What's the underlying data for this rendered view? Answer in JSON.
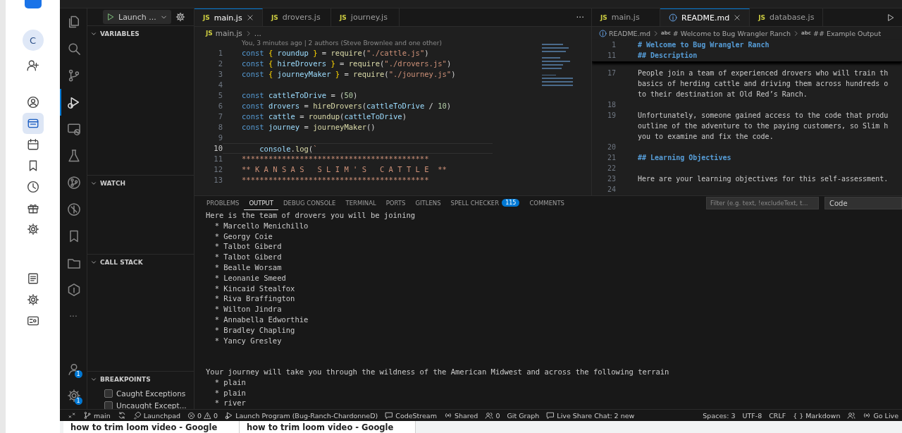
{
  "rail": {
    "avatar": "C",
    "items": [
      {
        "selected": false
      },
      {
        "selected": false
      },
      {
        "selected": true
      },
      {
        "selected": false
      },
      {
        "selected": false
      },
      {
        "selected": false
      },
      {
        "selected": false
      },
      {
        "selected": false
      },
      {
        "selected": false
      },
      {
        "selected": false
      },
      {
        "selected": false
      }
    ]
  },
  "activity_bar": {
    "items": [
      {
        "selected": false
      },
      {
        "selected": false
      },
      {
        "selected": false
      },
      {
        "selected": true
      },
      {
        "selected": false
      },
      {
        "selected": false
      },
      {
        "selected": false
      },
      {
        "selected": false
      },
      {
        "selected": false
      },
      {
        "selected": false
      },
      {
        "selected": false
      }
    ],
    "more": "···",
    "account_badge": "1",
    "manage_badge": "1"
  },
  "debug_toolbar": {
    "config": "Launch ..."
  },
  "sidebar": {
    "sections": [
      {
        "title": "VARIABLES",
        "expanded": true
      },
      {
        "title": "WATCH",
        "expanded": true
      },
      {
        "title": "CALL STACK",
        "expanded": true
      },
      {
        "title": "BREAKPOINTS",
        "expanded": true,
        "items": [
          {
            "label": "Caught Exceptions",
            "checked": false
          },
          {
            "label": "Uncaught Except...",
            "checked": false
          }
        ]
      }
    ]
  },
  "left_editor": {
    "tabs": [
      {
        "label": "main.js",
        "kind": "js",
        "icon_text": "JS",
        "selected": true
      },
      {
        "label": "drovers.js",
        "kind": "js",
        "icon_text": "JS",
        "selected": false
      },
      {
        "label": "journey.js",
        "kind": "js",
        "icon_text": "JS",
        "selected": false
      }
    ],
    "more": "···",
    "breadcrumb": [
      {
        "icon_text": "JS",
        "text": "main.js"
      },
      {
        "text": "..."
      }
    ],
    "blame": "You, 3 minutes ago | 2 authors (Steve Brownlee and one other)",
    "lines": [
      {
        "number": "1",
        "current": false,
        "tokens": [
          {
            "kind": "kw",
            "text": "const "
          },
          {
            "kind": "brace",
            "text": "{ "
          },
          {
            "kind": "var",
            "text": "roundup"
          },
          {
            "kind": "brace",
            "text": " }"
          },
          {
            "kind": "punct",
            "text": " = "
          },
          {
            "kind": "func",
            "text": "require"
          },
          {
            "kind": "punct",
            "text": "("
          },
          {
            "kind": "str",
            "text": "\"./cattle.js\""
          },
          {
            "kind": "punct",
            "text": ")"
          }
        ]
      },
      {
        "number": "2",
        "current": false,
        "tokens": [
          {
            "kind": "kw",
            "text": "const "
          },
          {
            "kind": "brace",
            "text": "{ "
          },
          {
            "kind": "var",
            "text": "hireDrovers"
          },
          {
            "kind": "brace",
            "text": " }"
          },
          {
            "kind": "punct",
            "text": " = "
          },
          {
            "kind": "func",
            "text": "require"
          },
          {
            "kind": "punct",
            "text": "("
          },
          {
            "kind": "str",
            "text": "\"./drovers.js\""
          },
          {
            "kind": "punct",
            "text": ")"
          }
        ]
      },
      {
        "number": "3",
        "current": false,
        "tokens": [
          {
            "kind": "kw",
            "text": "const "
          },
          {
            "kind": "brace",
            "text": "{ "
          },
          {
            "kind": "var",
            "text": "journeyMaker"
          },
          {
            "kind": "brace",
            "text": " }"
          },
          {
            "kind": "punct",
            "text": " = "
          },
          {
            "kind": "func",
            "text": "require"
          },
          {
            "kind": "punct",
            "text": "("
          },
          {
            "kind": "str",
            "text": "\"./journey.js\""
          },
          {
            "kind": "punct",
            "text": ")"
          }
        ]
      },
      {
        "number": "4",
        "current": false
      },
      {
        "number": "5",
        "current": false,
        "tokens": [
          {
            "kind": "kw",
            "text": "const "
          },
          {
            "kind": "var",
            "text": "cattleToDrive"
          },
          {
            "kind": "punct",
            "text": " = ("
          },
          {
            "kind": "num",
            "text": "50"
          },
          {
            "kind": "punct",
            "text": ")"
          }
        ]
      },
      {
        "number": "6",
        "current": false,
        "tokens": [
          {
            "kind": "kw",
            "text": "const "
          },
          {
            "kind": "var",
            "text": "drovers"
          },
          {
            "kind": "punct",
            "text": " = "
          },
          {
            "kind": "func",
            "text": "hireDrovers"
          },
          {
            "kind": "punct",
            "text": "("
          },
          {
            "kind": "var",
            "text": "cattleToDrive"
          },
          {
            "kind": "punct",
            "text": " / "
          },
          {
            "kind": "num",
            "text": "10"
          },
          {
            "kind": "punct",
            "text": ")"
          }
        ]
      },
      {
        "number": "7",
        "current": false,
        "tokens": [
          {
            "kind": "kw",
            "text": "const "
          },
          {
            "kind": "var",
            "text": "cattle"
          },
          {
            "kind": "punct",
            "text": " = "
          },
          {
            "kind": "func",
            "text": "roundup"
          },
          {
            "kind": "punct",
            "text": "("
          },
          {
            "kind": "var",
            "text": "cattleToDrive"
          },
          {
            "kind": "punct",
            "text": ")"
          }
        ]
      },
      {
        "number": "8",
        "current": false,
        "tokens": [
          {
            "kind": "kw",
            "text": "const "
          },
          {
            "kind": "var",
            "text": "journey"
          },
          {
            "kind": "punct",
            "text": " = "
          },
          {
            "kind": "func",
            "text": "journeyMaker"
          },
          {
            "kind": "punct",
            "text": "()"
          }
        ]
      },
      {
        "number": "9",
        "current": false
      },
      {
        "number": "10",
        "current": true,
        "tokens": [
          {
            "kind": "var",
            "text": "    console"
          },
          {
            "kind": "punct",
            "text": "."
          },
          {
            "kind": "func",
            "text": "log"
          },
          {
            "kind": "punct",
            "text": "("
          },
          {
            "kind": "str",
            "text": "`"
          }
        ]
      },
      {
        "number": "11",
        "current": false,
        "tokens": [
          {
            "kind": "str",
            "text": "******************************************"
          }
        ]
      },
      {
        "number": "12",
        "current": false,
        "tokens": [
          {
            "kind": "str",
            "text": "** K A N S A S   S L I M ' S   C A T T L E  **"
          }
        ]
      },
      {
        "number": "13",
        "current": false,
        "tokens": [
          {
            "kind": "str",
            "text": "******************************************"
          }
        ]
      }
    ]
  },
  "right_editor": {
    "tabs": [
      {
        "label": "main.js",
        "kind": "js",
        "icon_text": "JS",
        "selected": false
      },
      {
        "label": "README.md",
        "kind": "info",
        "selected": true
      },
      {
        "label": "database.js",
        "kind": "js",
        "icon_text": "JS",
        "selected": false
      }
    ],
    "breadcrumb": [
      {
        "text": "README.md"
      },
      {
        "icon_text": "abc",
        "text": "# Welcome to Bug Wrangler Ranch"
      },
      {
        "icon_text": "abc",
        "text": "## Example Output"
      }
    ],
    "sticky": [
      {
        "number": "1",
        "kind": "heading",
        "text": "# Welcome to Bug Wrangler Ranch"
      },
      {
        "number": "11",
        "kind": "heading",
        "text": "## Description"
      }
    ],
    "lines": [
      {
        "number": "17",
        "kind": "text",
        "text": "People join a team of experienced drovers who will train th"
      },
      {
        "kind": "text",
        "text": "basics of herding cattle and driving them across hundreds o"
      },
      {
        "kind": "text",
        "text": "to their destination at Old Red’s Ranch."
      },
      {
        "number": "18",
        "kind": "blank"
      },
      {
        "number": "19",
        "kind": "text",
        "text": "Unfortunately, someone gained access to the code that produ"
      },
      {
        "kind": "text",
        "text": "outline of the adventure to the paying customers, so Slim h"
      },
      {
        "kind": "text",
        "text": "you to examine and fix the code."
      },
      {
        "number": "20",
        "kind": "blank"
      },
      {
        "number": "21",
        "kind": "heading",
        "text": "## Learning Objectives"
      },
      {
        "number": "22",
        "kind": "blank"
      },
      {
        "number": "23",
        "kind": "text",
        "text": "Here are your learning objectives for this self-assessment."
      },
      {
        "number": "24",
        "kind": "blank"
      }
    ]
  },
  "panel": {
    "tabs": [
      {
        "label": "PROBLEMS",
        "selected": false
      },
      {
        "label": "OUTPUT",
        "selected": true
      },
      {
        "label": "DEBUG CONSOLE",
        "selected": false
      },
      {
        "label": "TERMINAL",
        "selected": false
      },
      {
        "label": "PORTS",
        "selected": false
      },
      {
        "label": "GITLENS",
        "selected": false
      },
      {
        "label": "SPELL CHECKER",
        "badge": "115",
        "selected": false
      },
      {
        "label": "COMMENTS",
        "selected": false
      }
    ],
    "filter": {
      "placeholder": "Filter (e.g. text, !excludeText, t..."
    },
    "channel": "Code",
    "output": [
      {
        "kind": "line",
        "text": "Here is the team of drovers you will be joining"
      },
      {
        "kind": "line",
        "text": "  * Marcello Menichillo"
      },
      {
        "kind": "line",
        "text": "  * Georgy Coie"
      },
      {
        "kind": "line",
        "text": "  * Talbot Giberd"
      },
      {
        "kind": "line",
        "text": "  * Talbot Giberd"
      },
      {
        "kind": "line",
        "text": "  * Bealle Worsam"
      },
      {
        "kind": "line",
        "text": "  * Leonanie Smeed"
      },
      {
        "kind": "line",
        "text": "  * Kincaid Stealfox"
      },
      {
        "kind": "line",
        "text": "  * Riva Braffington"
      },
      {
        "kind": "line",
        "text": "  * Wilton Jindra"
      },
      {
        "kind": "line",
        "text": "  * Annabella Edworthie"
      },
      {
        "kind": "line",
        "text": "  * Bradley Chapling"
      },
      {
        "kind": "line",
        "text": "  * Yancy Gresley"
      },
      {
        "kind": "blank"
      },
      {
        "kind": "blank"
      },
      {
        "kind": "line",
        "text": "Your journey will take you through the wildness of the American Midwest and across the following terrain"
      },
      {
        "kind": "line",
        "text": "  * plain"
      },
      {
        "kind": "line",
        "text": "  * plain"
      },
      {
        "kind": "line",
        "text": "  * river"
      }
    ]
  },
  "status_bar": {
    "left": [
      {
        "kind": "remote"
      },
      {
        "kind": "branch",
        "text": "main"
      },
      {
        "kind": "sync"
      },
      {
        "kind": "rocket",
        "text": "Launchpad"
      },
      {
        "kind": "problems",
        "errors": "0",
        "warnings": "0"
      },
      {
        "kind": "debug",
        "text": "Launch Program (Bug-Ranch-ChardonneD)"
      },
      {
        "kind": "chat",
        "text": "CodeStream"
      },
      {
        "kind": "radio",
        "text": "Shared"
      },
      {
        "kind": "people",
        "text": "0"
      },
      {
        "kind": "plain",
        "text": "Git Graph"
      },
      {
        "kind": "chat",
        "text": "Live Share Chat: 2 new"
      }
    ],
    "right": [
      {
        "kind": "plain",
        "text": "Spaces: 3"
      },
      {
        "kind": "plain",
        "text": "UTF-8"
      },
      {
        "kind": "plain",
        "text": "CRLF"
      },
      {
        "kind": "braces",
        "icon_text": "{ }",
        "text": "Markdown"
      },
      {
        "kind": "people"
      },
      {
        "kind": "radio",
        "text": "Go Live"
      }
    ]
  },
  "browser_tabs": [
    "how to trim loom video - Google",
    "how to trim loom video - Google"
  ]
}
